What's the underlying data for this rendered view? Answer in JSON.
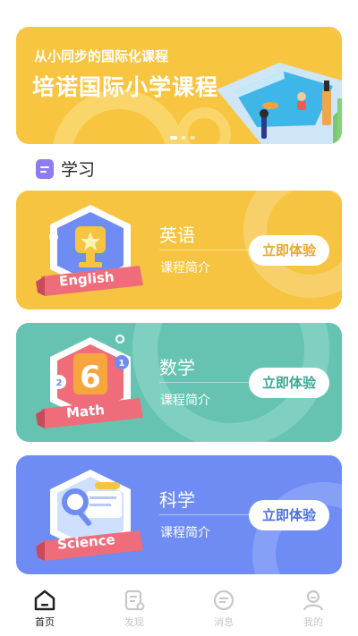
{
  "banner": {
    "subtitle": "从小同步的国际化课程",
    "title": "培诺国际小学课程",
    "page_count": 3,
    "active_page": 1
  },
  "section": {
    "title": "学习"
  },
  "courses": [
    {
      "name": "英语",
      "desc": "课程简介",
      "button": "立即体验",
      "badge_text": "English",
      "color": "#f6c440"
    },
    {
      "name": "数学",
      "desc": "课程简介",
      "button": "立即体验",
      "badge_text": "Math",
      "badge_number": "6",
      "color": "#66c3b2"
    },
    {
      "name": "科学",
      "desc": "课程简介",
      "button": "立即体验",
      "badge_text": "Science",
      "color": "#6e8cf4"
    }
  ],
  "tabbar": {
    "items": [
      {
        "label": "首页",
        "icon": "home-icon",
        "active": true
      },
      {
        "label": "发现",
        "icon": "discover-icon",
        "active": false
      },
      {
        "label": "消息",
        "icon": "message-icon",
        "active": false
      },
      {
        "label": "我的",
        "icon": "profile-icon",
        "active": false
      }
    ]
  }
}
